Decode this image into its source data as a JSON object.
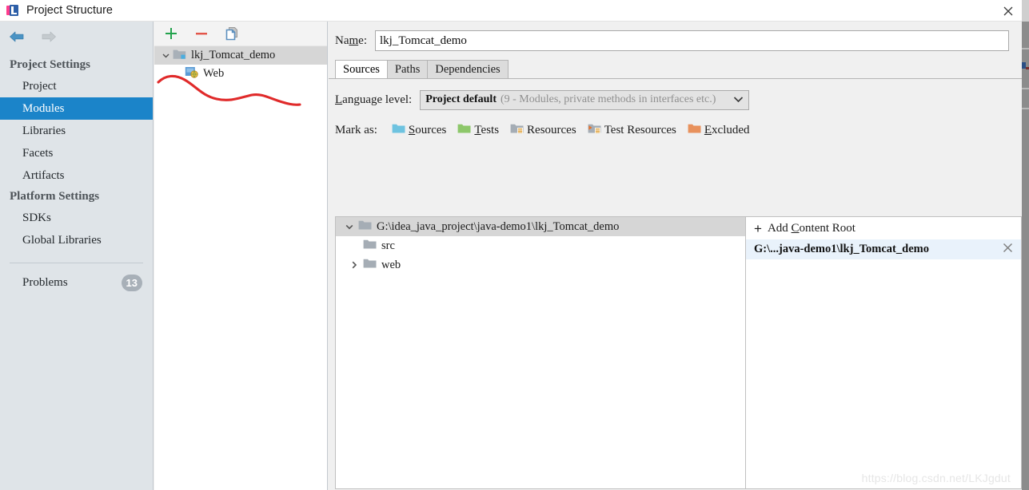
{
  "window": {
    "title": "Project Structure",
    "app_icon": "intellij-idea-icon",
    "close_label": "✕"
  },
  "nav": {
    "back_icon": "arrow-left-icon",
    "forward_icon": "arrow-right-icon"
  },
  "sidebar": {
    "groups": [
      {
        "title": "Project Settings",
        "items": [
          {
            "label": "Project",
            "selected": false
          },
          {
            "label": "Modules",
            "selected": true
          },
          {
            "label": "Libraries",
            "selected": false
          },
          {
            "label": "Facets",
            "selected": false
          },
          {
            "label": "Artifacts",
            "selected": false
          }
        ]
      },
      {
        "title": "Platform Settings",
        "items": [
          {
            "label": "SDKs",
            "selected": false
          },
          {
            "label": "Global Libraries",
            "selected": false
          }
        ]
      }
    ],
    "problems": {
      "label": "Problems",
      "count": "13"
    }
  },
  "module_panel": {
    "toolbar": [
      {
        "name": "add-module-button",
        "icon": "plus-icon",
        "color": "#23a24d"
      },
      {
        "name": "remove-module-button",
        "icon": "minus-icon",
        "color": "#e2564a"
      },
      {
        "name": "copy-module-button",
        "icon": "copy-icon",
        "color": "#5b8fbe"
      }
    ],
    "tree": [
      {
        "label": "lkj_Tomcat_demo",
        "icon": "module-folder-icon",
        "level": 0,
        "expanded": true,
        "selected": true
      },
      {
        "label": "Web",
        "icon": "web-facet-icon",
        "level": 1,
        "expanded": false,
        "selected": false
      }
    ],
    "annotation": "red-handdrawn-underline"
  },
  "main": {
    "name_field": {
      "label": "Name:",
      "label_mnemonic": "m",
      "value": "lkj_Tomcat_demo",
      "placeholder": ""
    },
    "tabs": [
      {
        "label": "Sources",
        "active": true
      },
      {
        "label": "Paths",
        "active": false
      },
      {
        "label": "Dependencies",
        "active": false
      }
    ],
    "language_level": {
      "label": "Language level:",
      "label_mnemonic": "L",
      "value_primary": "Project default",
      "value_secondary": "(9 - Modules, private methods in interfaces etc.)",
      "chevron_icon": "chevron-down-icon"
    },
    "mark_as": {
      "label": "Mark as:",
      "options": [
        {
          "label": "Sources",
          "mnemonic": "S",
          "rest": "ources",
          "icon": "folder-sources-icon",
          "color": "#6ec3e0"
        },
        {
          "label": "Tests",
          "mnemonic": "T",
          "rest": "ests",
          "icon": "folder-tests-icon",
          "color": "#8dc76a"
        },
        {
          "label": "Resources",
          "mnemonic": "",
          "rest": "Resources",
          "icon": "folder-resources-icon",
          "color": "#a5adb5"
        },
        {
          "label": "Test Resources",
          "mnemonic": "",
          "rest": "Test Resources",
          "icon": "folder-test-resources-icon",
          "color": "#a5adb5"
        },
        {
          "label": "Excluded",
          "mnemonic": "E",
          "rest": "xcluded",
          "icon": "folder-excluded-icon",
          "color": "#e8915c"
        }
      ]
    },
    "content_tree": [
      {
        "label": "G:\\idea_java_project\\java-demo1\\lkj_Tomcat_demo",
        "icon": "folder-icon",
        "level": 0,
        "twisty": "expanded",
        "selected": true
      },
      {
        "label": "src",
        "icon": "folder-icon",
        "level": 1,
        "twisty": "none",
        "selected": false
      },
      {
        "label": "web",
        "icon": "folder-icon",
        "level": 1,
        "twisty": "collapsed",
        "selected": false
      }
    ],
    "content_roots": {
      "add_label_prefix": "Add ",
      "add_mnemonic": "C",
      "add_label_suffix": "ontent Root",
      "plus_icon": "plus-icon",
      "items": [
        {
          "label": "G:\\...java-demo1\\lkj_Tomcat_demo",
          "remove_icon": "close-icon",
          "selected": true
        }
      ]
    }
  },
  "watermark": "https://blog.csdn.net/LKJgdut",
  "colors": {
    "selection_blue": "#1b84c9",
    "tree_selection_gray": "#d6d6d6",
    "root_selection_blue": "#e9f2fb",
    "sidebar_bg": "#dfe4e8",
    "panel_bg": "#f0f0f0",
    "annotation_red": "#e02a2a"
  }
}
